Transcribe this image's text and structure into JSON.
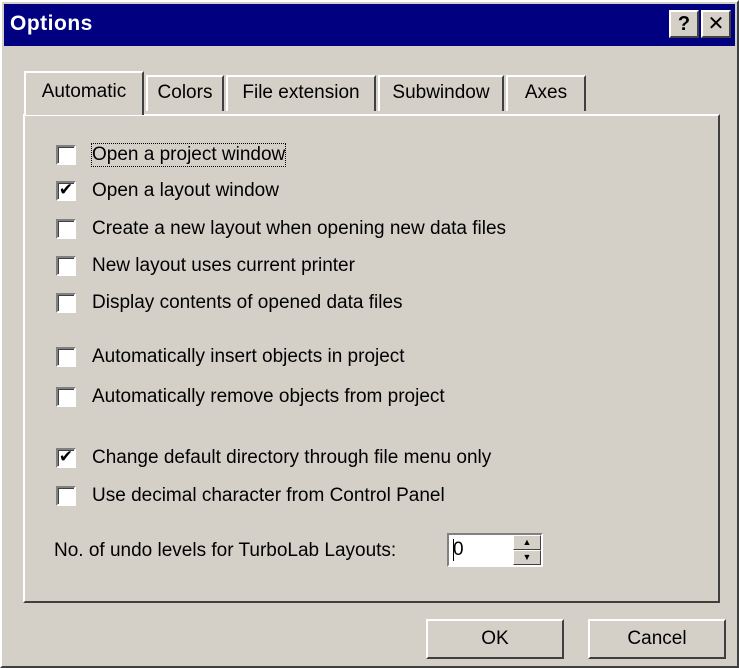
{
  "window": {
    "title": "Options",
    "help_label": "?",
    "close_label": "✕"
  },
  "tabs": [
    {
      "label": "Automatic",
      "active": true
    },
    {
      "label": "Colors",
      "active": false
    },
    {
      "label": "File extension",
      "active": false
    },
    {
      "label": "Subwindow",
      "active": false
    },
    {
      "label": "Axes",
      "active": false
    }
  ],
  "options": [
    {
      "label": "Open a project window",
      "checked": false
    },
    {
      "label": "Open a layout window",
      "checked": true
    },
    {
      "label": "Create a new layout when opening new data files",
      "checked": false
    },
    {
      "label": "New layout uses current printer",
      "checked": false
    },
    {
      "label": "Display contents of opened data files",
      "checked": false
    },
    {
      "label": "Automatically insert objects in project",
      "checked": false
    },
    {
      "label": "Automatically remove objects from project",
      "checked": false
    },
    {
      "label": "Change default directory through file menu only",
      "checked": true
    },
    {
      "label": "Use decimal character from Control Panel",
      "checked": false
    }
  ],
  "check_mark": "✔",
  "undo": {
    "label": "No. of undo levels for TurboLab Layouts:",
    "value": "0",
    "up_glyph": "▲",
    "down_glyph": "▼"
  },
  "buttons": {
    "ok": "OK",
    "cancel": "Cancel"
  }
}
